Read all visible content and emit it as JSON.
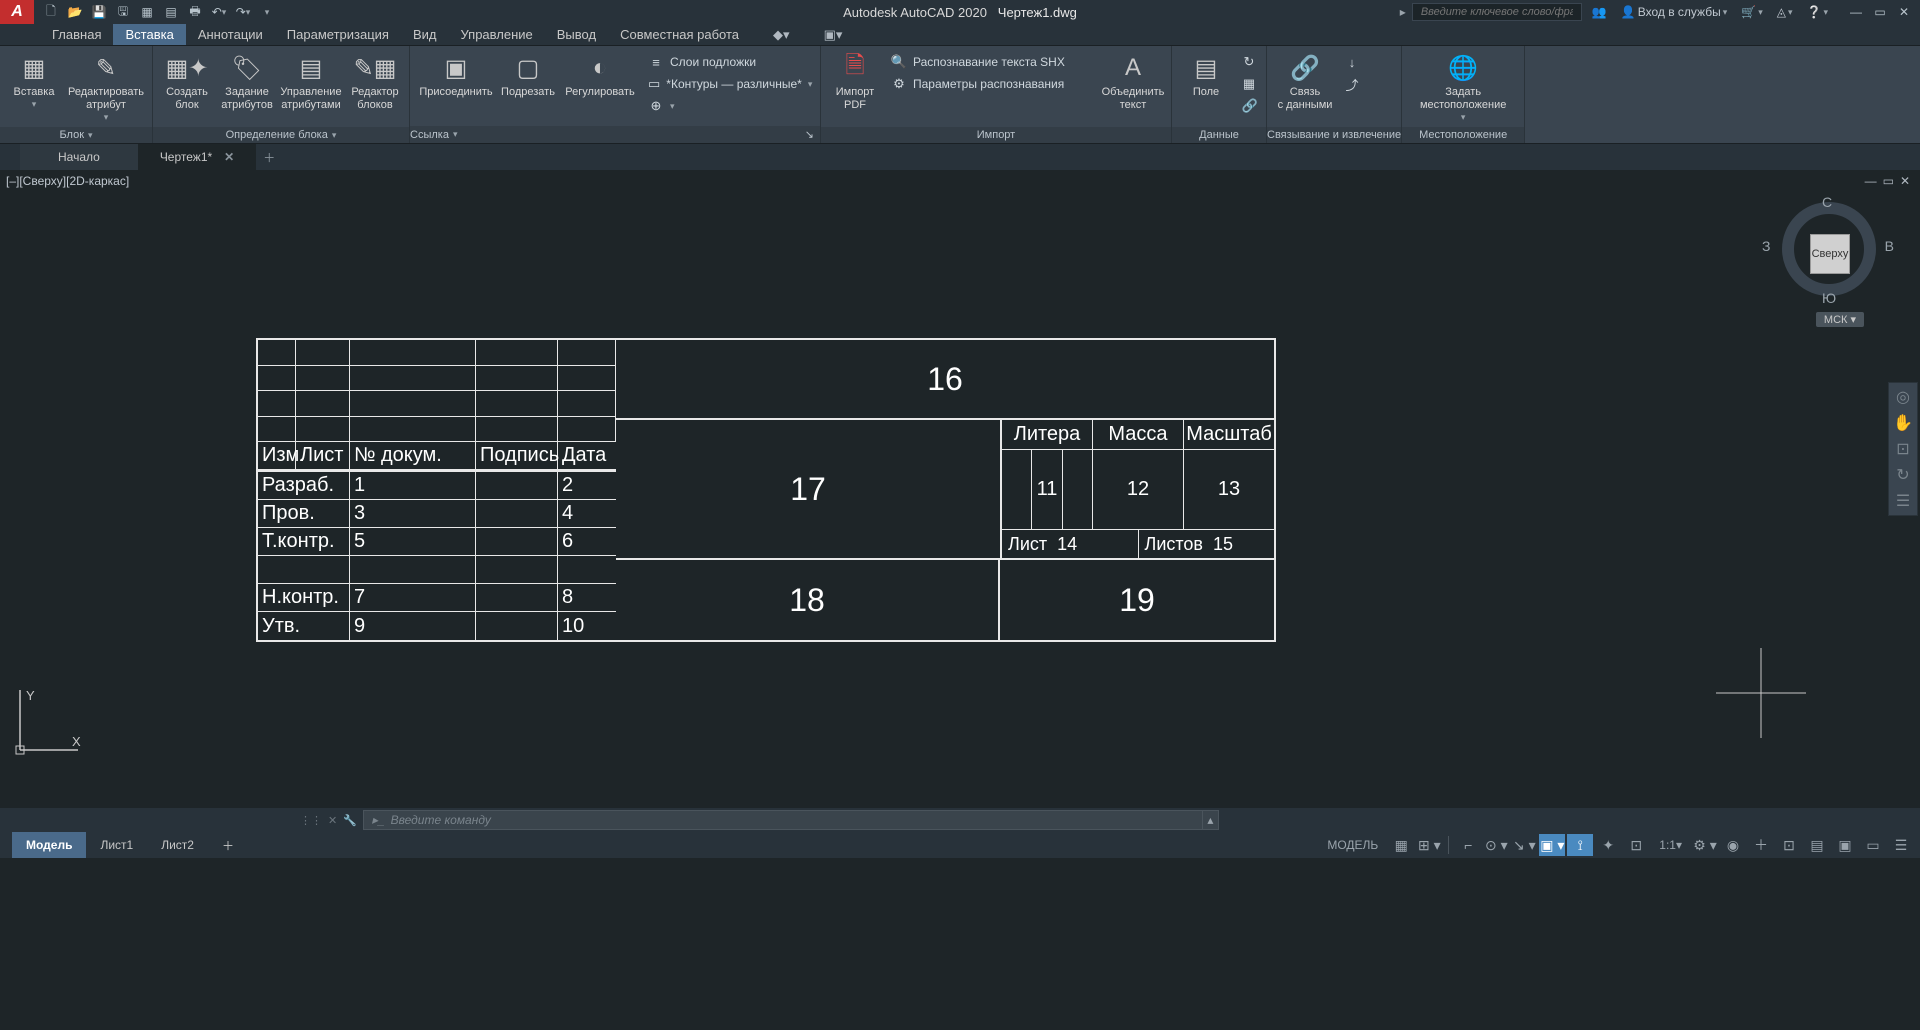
{
  "title": {
    "app": "Autodesk AutoCAD 2020",
    "file": "Чертеж1.dwg"
  },
  "search_placeholder": "Введите ключевое слово/фразу",
  "signin": "Вход в службы",
  "ribbon_tabs": [
    "Главная",
    "Вставка",
    "Аннотации",
    "Параметризация",
    "Вид",
    "Управление",
    "Вывод",
    "Совместная работа"
  ],
  "active_tab": "Вставка",
  "panels": {
    "block": {
      "title": "Блок",
      "insert": "Вставка",
      "edit_attr": "Редактировать\nатрибут"
    },
    "blockdef": {
      "title": "Определение блока",
      "create": "Создать\nблок",
      "set_attr": "Задание\nатрибутов",
      "manage_attr": "Управление\nатрибутами",
      "blocked": "Редактор\nблоков"
    },
    "link": {
      "title": "Ссылка",
      "attach": "Присоединить",
      "clip": "Подрезать",
      "adjust": "Регулировать",
      "underlay": "Слои подложки",
      "contours": "*Контуры — различные*"
    },
    "import": {
      "title": "Импорт",
      "pdf": "Импорт\nPDF",
      "ocr": "Распознавание текста SHX",
      "ocr_params": "Параметры распознавания",
      "merge_text": "Объединить\nтекст"
    },
    "data": {
      "title": "Данные",
      "field": "Поле"
    },
    "linking": {
      "title": "Связывание и извлечение",
      "datalink": "Связь\nс данными"
    },
    "location": {
      "title": "Местоположение",
      "set_loc": "Задать\nместоположение"
    }
  },
  "doc_tabs": {
    "start": "Начало",
    "active": "Чертеж1*"
  },
  "view_label": "[–][Сверху][2D-каркас]",
  "viewcube": {
    "face": "Сверху",
    "n": "С",
    "s": "Ю",
    "e": "В",
    "w": "З",
    "wcs": "МСК"
  },
  "titleblock": {
    "headers": {
      "izm": "Изм.",
      "list": "Лист",
      "docn": "№ докум.",
      "sign": "Подпись",
      "date": "Дата"
    },
    "rows": [
      {
        "role": "Разраб.",
        "doc": "1",
        "date": "2"
      },
      {
        "role": "Пров.",
        "doc": "3",
        "date": "4"
      },
      {
        "role": "Т.контр.",
        "doc": "5",
        "date": "6"
      },
      {
        "role": "",
        "doc": "",
        "date": ""
      },
      {
        "role": "Н.контр.",
        "doc": "7",
        "date": "8"
      },
      {
        "role": "Утв.",
        "doc": "9",
        "date": "10"
      }
    ],
    "main_top": "16",
    "main_mid": "17",
    "lit_hdr": "Литера",
    "mass_hdr": "Масса",
    "scale_hdr": "Масштаб",
    "lit_val": "11",
    "mass_val": "12",
    "scale_val": "13",
    "sheet_lbl": "Лист",
    "sheet_val": "14",
    "sheets_lbl": "Листов",
    "sheets_val": "15",
    "bot_left": "18",
    "bot_right": "19"
  },
  "cmd_placeholder": "Введите команду",
  "layout_tabs": [
    "Модель",
    "Лист1",
    "Лист2"
  ],
  "status": {
    "model": "МОДЕЛЬ",
    "scale": "1:1"
  }
}
